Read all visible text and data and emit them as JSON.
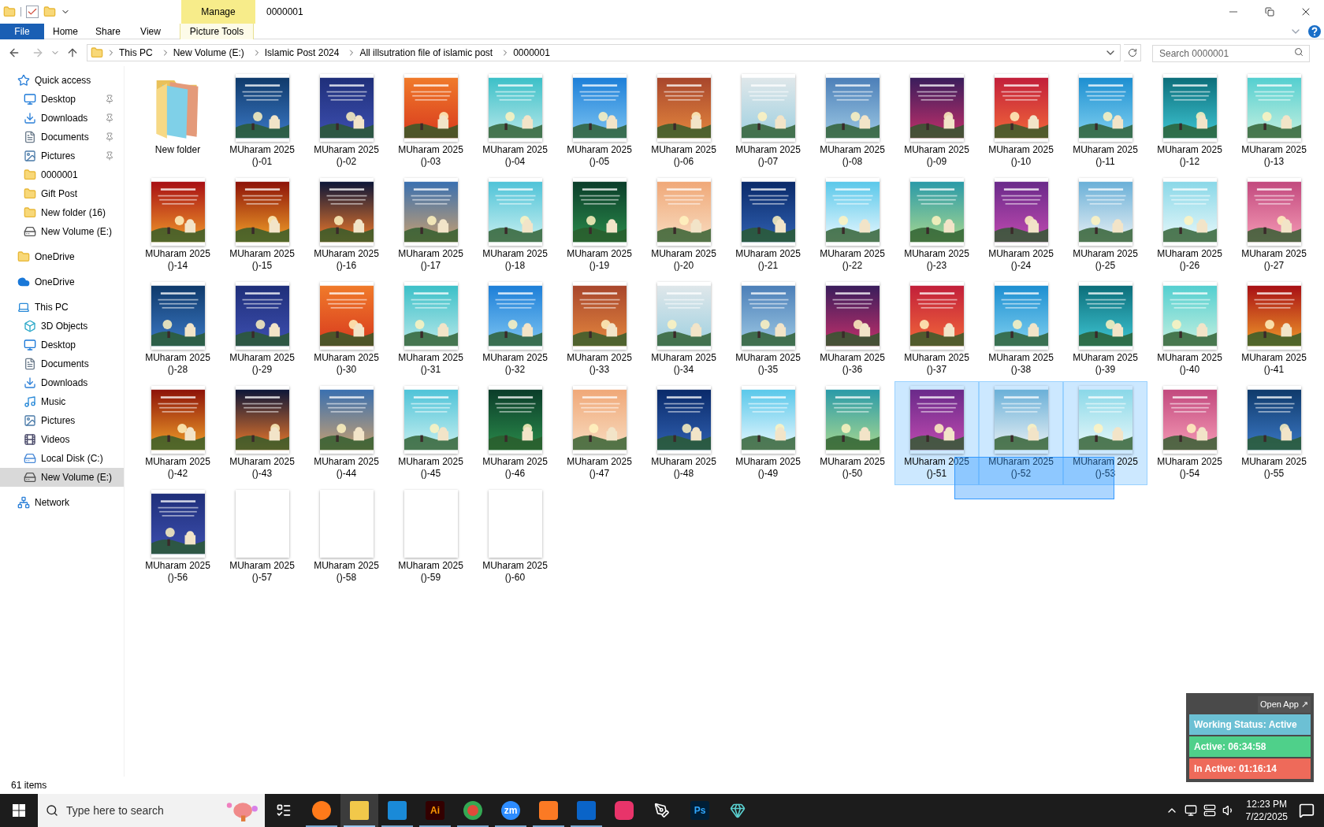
{
  "window": {
    "title": "0000001",
    "context_tab": "Manage"
  },
  "ribbon_tabs": [
    {
      "label": "File",
      "selected": true,
      "kind": "file"
    },
    {
      "label": "Home",
      "selected": false,
      "kind": "tab"
    },
    {
      "label": "Share",
      "selected": false,
      "kind": "tab"
    },
    {
      "label": "View",
      "selected": false,
      "kind": "tab"
    },
    {
      "label": "Picture Tools",
      "selected": false,
      "kind": "context"
    }
  ],
  "breadcrumb": [
    "This PC",
    "New Volume (E:)",
    "Islamic Post 2024",
    "All illsutration file of islamic post",
    "0000001"
  ],
  "search": {
    "placeholder": "Search 0000001"
  },
  "sidebar": [
    {
      "label": "Quick access",
      "kind": "star",
      "selected": false,
      "children": [
        {
          "label": "Desktop",
          "kind": "desktop",
          "pinned": true,
          "selected": false
        },
        {
          "label": "Downloads",
          "kind": "download",
          "pinned": true,
          "selected": false
        },
        {
          "label": "Documents",
          "kind": "document",
          "pinned": true,
          "selected": false
        },
        {
          "label": "Pictures",
          "kind": "pictures",
          "pinned": true,
          "selected": false
        },
        {
          "label": "0000001",
          "kind": "folder",
          "pinned": false,
          "selected": false
        },
        {
          "label": "Gift Post",
          "kind": "folder",
          "pinned": false,
          "selected": false
        },
        {
          "label": "New folder (16)",
          "kind": "folder",
          "pinned": false,
          "selected": false
        },
        {
          "label": "New Volume (E:)",
          "kind": "drive",
          "pinned": false,
          "selected": false
        }
      ]
    },
    {
      "label": "OneDrive",
      "kind": "folder",
      "selected": false
    },
    {
      "label": "OneDrive",
      "kind": "cloud",
      "selected": false
    },
    {
      "label": "This PC",
      "kind": "pc",
      "selected": false,
      "children": [
        {
          "label": "3D Objects",
          "kind": "cube",
          "pinned": false,
          "selected": false
        },
        {
          "label": "Desktop",
          "kind": "desktop",
          "pinned": false,
          "selected": false
        },
        {
          "label": "Documents",
          "kind": "document",
          "pinned": false,
          "selected": false
        },
        {
          "label": "Downloads",
          "kind": "download",
          "pinned": false,
          "selected": false
        },
        {
          "label": "Music",
          "kind": "music",
          "pinned": false,
          "selected": false
        },
        {
          "label": "Pictures",
          "kind": "pictures",
          "pinned": false,
          "selected": false
        },
        {
          "label": "Videos",
          "kind": "videos",
          "pinned": false,
          "selected": false
        },
        {
          "label": "Local Disk (C:)",
          "kind": "disk",
          "pinned": false,
          "selected": false
        },
        {
          "label": "New Volume (E:)",
          "kind": "drive",
          "pinned": false,
          "selected": true
        }
      ]
    },
    {
      "label": "Network",
      "kind": "network",
      "selected": false
    }
  ],
  "files": [
    {
      "name": "New folder",
      "kind": "folder",
      "selected": false
    },
    {
      "name": "MUharam 2025 ()-01",
      "kind": "picture",
      "selected": false
    },
    {
      "name": "MUharam 2025 ()-02",
      "kind": "picture",
      "selected": false
    },
    {
      "name": "MUharam 2025 ()-03",
      "kind": "picture",
      "selected": false
    },
    {
      "name": "MUharam 2025 ()-04",
      "kind": "picture",
      "selected": false
    },
    {
      "name": "MUharam 2025 ()-05",
      "kind": "picture",
      "selected": false
    },
    {
      "name": "MUharam 2025 ()-06",
      "kind": "picture",
      "selected": false
    },
    {
      "name": "MUharam 2025 ()-07",
      "kind": "picture",
      "selected": false
    },
    {
      "name": "MUharam 2025 ()-08",
      "kind": "picture",
      "selected": false
    },
    {
      "name": "MUharam 2025 ()-09",
      "kind": "picture",
      "selected": false
    },
    {
      "name": "MUharam 2025 ()-10",
      "kind": "picture",
      "selected": false
    },
    {
      "name": "MUharam 2025 ()-11",
      "kind": "picture",
      "selected": false
    },
    {
      "name": "MUharam 2025 ()-12",
      "kind": "picture",
      "selected": false
    },
    {
      "name": "MUharam 2025 ()-13",
      "kind": "picture",
      "selected": false
    },
    {
      "name": "MUharam 2025 ()-14",
      "kind": "picture",
      "selected": false
    },
    {
      "name": "MUharam 2025 ()-15",
      "kind": "picture",
      "selected": false
    },
    {
      "name": "MUharam 2025 ()-16",
      "kind": "picture",
      "selected": false
    },
    {
      "name": "MUharam 2025 ()-17",
      "kind": "picture",
      "selected": false
    },
    {
      "name": "MUharam 2025 ()-18",
      "kind": "picture",
      "selected": false
    },
    {
      "name": "MUharam 2025 ()-19",
      "kind": "picture",
      "selected": false
    },
    {
      "name": "MUharam 2025 ()-20",
      "kind": "picture",
      "selected": false
    },
    {
      "name": "MUharam 2025 ()-21",
      "kind": "picture",
      "selected": false
    },
    {
      "name": "MUharam 2025 ()-22",
      "kind": "picture",
      "selected": false
    },
    {
      "name": "MUharam 2025 ()-23",
      "kind": "picture",
      "selected": false
    },
    {
      "name": "MUharam 2025 ()-24",
      "kind": "picture",
      "selected": false
    },
    {
      "name": "MUharam 2025 ()-25",
      "kind": "picture",
      "selected": false
    },
    {
      "name": "MUharam 2025 ()-26",
      "kind": "picture",
      "selected": false
    },
    {
      "name": "MUharam 2025 ()-27",
      "kind": "picture",
      "selected": false
    },
    {
      "name": "MUharam 2025 ()-28",
      "kind": "picture",
      "selected": false
    },
    {
      "name": "MUharam 2025 ()-29",
      "kind": "picture",
      "selected": false
    },
    {
      "name": "MUharam 2025 ()-30",
      "kind": "picture",
      "selected": false
    },
    {
      "name": "MUharam 2025 ()-31",
      "kind": "picture",
      "selected": false
    },
    {
      "name": "MUharam 2025 ()-32",
      "kind": "picture",
      "selected": false
    },
    {
      "name": "MUharam 2025 ()-33",
      "kind": "picture",
      "selected": false
    },
    {
      "name": "MUharam 2025 ()-34",
      "kind": "picture",
      "selected": false
    },
    {
      "name": "MUharam 2025 ()-35",
      "kind": "picture",
      "selected": false
    },
    {
      "name": "MUharam 2025 ()-36",
      "kind": "picture",
      "selected": false
    },
    {
      "name": "MUharam 2025 ()-37",
      "kind": "picture",
      "selected": false
    },
    {
      "name": "MUharam 2025 ()-38",
      "kind": "picture",
      "selected": false
    },
    {
      "name": "MUharam 2025 ()-39",
      "kind": "picture",
      "selected": false
    },
    {
      "name": "MUharam 2025 ()-40",
      "kind": "picture",
      "selected": false
    },
    {
      "name": "MUharam 2025 ()-41",
      "kind": "picture",
      "selected": false
    },
    {
      "name": "MUharam 2025 ()-42",
      "kind": "picture",
      "selected": false
    },
    {
      "name": "MUharam 2025 ()-43",
      "kind": "picture",
      "selected": false
    },
    {
      "name": "MUharam 2025 ()-44",
      "kind": "picture",
      "selected": false
    },
    {
      "name": "MUharam 2025 ()-45",
      "kind": "picture",
      "selected": false
    },
    {
      "name": "MUharam 2025 ()-46",
      "kind": "picture",
      "selected": false
    },
    {
      "name": "MUharam 2025 ()-47",
      "kind": "picture",
      "selected": false
    },
    {
      "name": "MUharam 2025 ()-48",
      "kind": "picture",
      "selected": false
    },
    {
      "name": "MUharam 2025 ()-49",
      "kind": "picture",
      "selected": false
    },
    {
      "name": "MUharam 2025 ()-50",
      "kind": "picture",
      "selected": false
    },
    {
      "name": "MUharam 2025 ()-51",
      "kind": "picture",
      "selected": true
    },
    {
      "name": "MUharam 2025 ()-52",
      "kind": "picture",
      "selected": true
    },
    {
      "name": "MUharam 2025 ()-53",
      "kind": "picture",
      "selected": true
    },
    {
      "name": "MUharam 2025 ()-54",
      "kind": "picture",
      "selected": false
    },
    {
      "name": "MUharam 2025 ()-55",
      "kind": "picture",
      "selected": false
    },
    {
      "name": "MUharam 2025 ()-56",
      "kind": "picture",
      "selected": false
    },
    {
      "name": "MUharam 2025 ()-57",
      "kind": "blank",
      "selected": false
    },
    {
      "name": "MUharam 2025 ()-58",
      "kind": "blank",
      "selected": false
    },
    {
      "name": "MUharam 2025 ()-59",
      "kind": "blank",
      "selected": false
    },
    {
      "name": "MUharam 2025 ()-60",
      "kind": "blank",
      "selected": false
    }
  ],
  "status_bar": {
    "item_count": "61 items"
  },
  "tracker": {
    "open_app": "Open App ↗",
    "status": "Working Status: Active",
    "active": "Active: 06:34:58",
    "inactive": "In Active: 01:16:14"
  },
  "taskbar": {
    "search_placeholder": "Type here to search",
    "apps": [
      {
        "kind": "firefox",
        "running": true,
        "selected": false
      },
      {
        "kind": "explorer",
        "running": true,
        "selected": true
      },
      {
        "kind": "vscode",
        "running": true,
        "selected": false
      },
      {
        "kind": "illustrator",
        "label": "Ai",
        "running": true,
        "selected": false
      },
      {
        "kind": "chrome",
        "running": true,
        "selected": false
      },
      {
        "kind": "zoom",
        "label": "zm",
        "running": true,
        "selected": false
      },
      {
        "kind": "xampp",
        "running": true,
        "selected": false
      },
      {
        "kind": "outlook",
        "running": true,
        "selected": false
      },
      {
        "kind": "creative",
        "running": false,
        "selected": false
      },
      {
        "kind": "pen",
        "running": false,
        "selected": false
      },
      {
        "kind": "photoshop",
        "label": "Ps",
        "running": false,
        "selected": false
      },
      {
        "kind": "gem",
        "running": false,
        "selected": false
      }
    ],
    "time": "12:23 PM",
    "date": "7/22/2025"
  }
}
